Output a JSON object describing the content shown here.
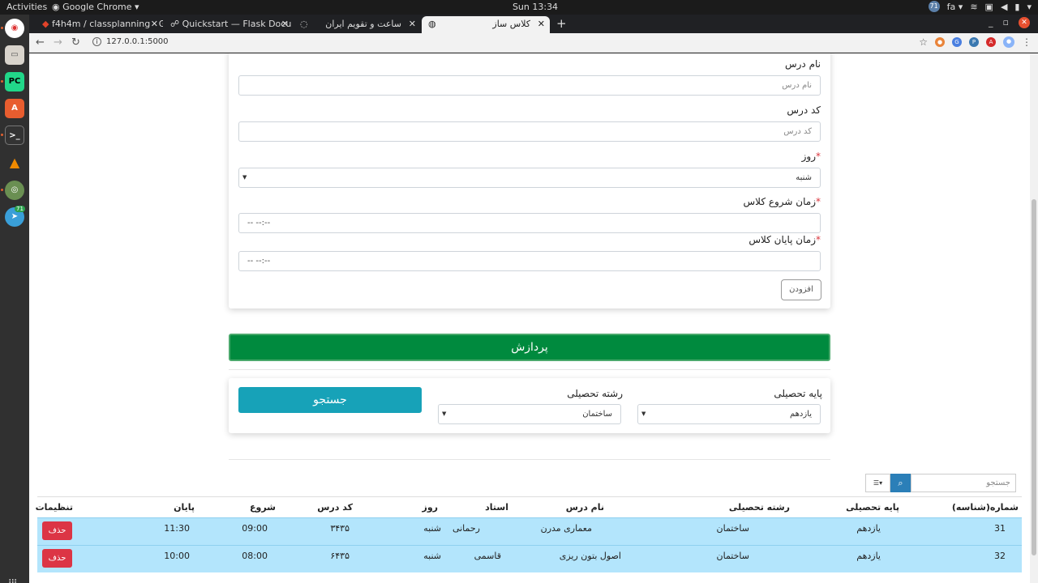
{
  "topbar": {
    "activities": "Activities",
    "app_name": "Google Chrome ▾",
    "clock": "Sun 13:34",
    "badge": "71",
    "lang": "fa ▾"
  },
  "dock": {
    "pycharm_label": "PC",
    "telegram_badge": "71"
  },
  "browser": {
    "tabs": [
      {
        "label": "f4h4m / classplanning · G"
      },
      {
        "label": "Quickstart — Flask Docu"
      },
      {
        "label": "ساعت و تقویم ایران"
      },
      {
        "label": "کلاس ساز"
      }
    ],
    "url": "127.0.0.1:5000"
  },
  "form": {
    "course_name_label": "نام درس",
    "course_name_placeholder": "نام درس",
    "course_code_label": "کد درس",
    "course_code_placeholder": "کد درس",
    "day_label": "روز",
    "day_value": "شنبه",
    "start_time_label": "زمان شروع کلاس",
    "start_time_value": "-- --:--",
    "end_time_label": "زمان پایان کلاس",
    "end_time_value": "-- --:--",
    "required_mark": "*",
    "add_button": "افزودن"
  },
  "process_button": "پردازش",
  "filter": {
    "grade_label": "پایه تحصیلی",
    "grade_value": "یازدهم",
    "field_label": "رشته تحصیلی",
    "field_value": "ساختمان",
    "search_button": "جستجو"
  },
  "table": {
    "search_placeholder": "جستجو",
    "columns": {
      "id": "شماره(شناسه)",
      "grade": "پایه تحصیلی",
      "field": "رشته تحصیلی",
      "name": "نام درس",
      "teacher": "استاد",
      "day": "روز",
      "code": "کد درس",
      "start": "شروع",
      "end": "پایان",
      "settings": "تنظیمات"
    },
    "rows": [
      {
        "id": "31",
        "grade": "یازدهم",
        "field": "ساختمان",
        "name": "معماری مدرن",
        "teacher": "رحمانی",
        "day": "شنبه",
        "code": "۳۴۳۵",
        "start": "09:00",
        "end": "11:30",
        "delete": "حذف"
      },
      {
        "id": "32",
        "grade": "یازدهم",
        "field": "ساختمان",
        "name": "اصول بتون ریزی",
        "teacher": "قاسمی",
        "day": "شنبه",
        "code": "۶۴۳۵",
        "start": "08:00",
        "end": "10:00",
        "delete": "حذف"
      }
    ]
  },
  "colors": {
    "process": "#008a3e",
    "search": "#17a2b8",
    "delete": "#dc3545",
    "row": "#b3e5fc"
  }
}
